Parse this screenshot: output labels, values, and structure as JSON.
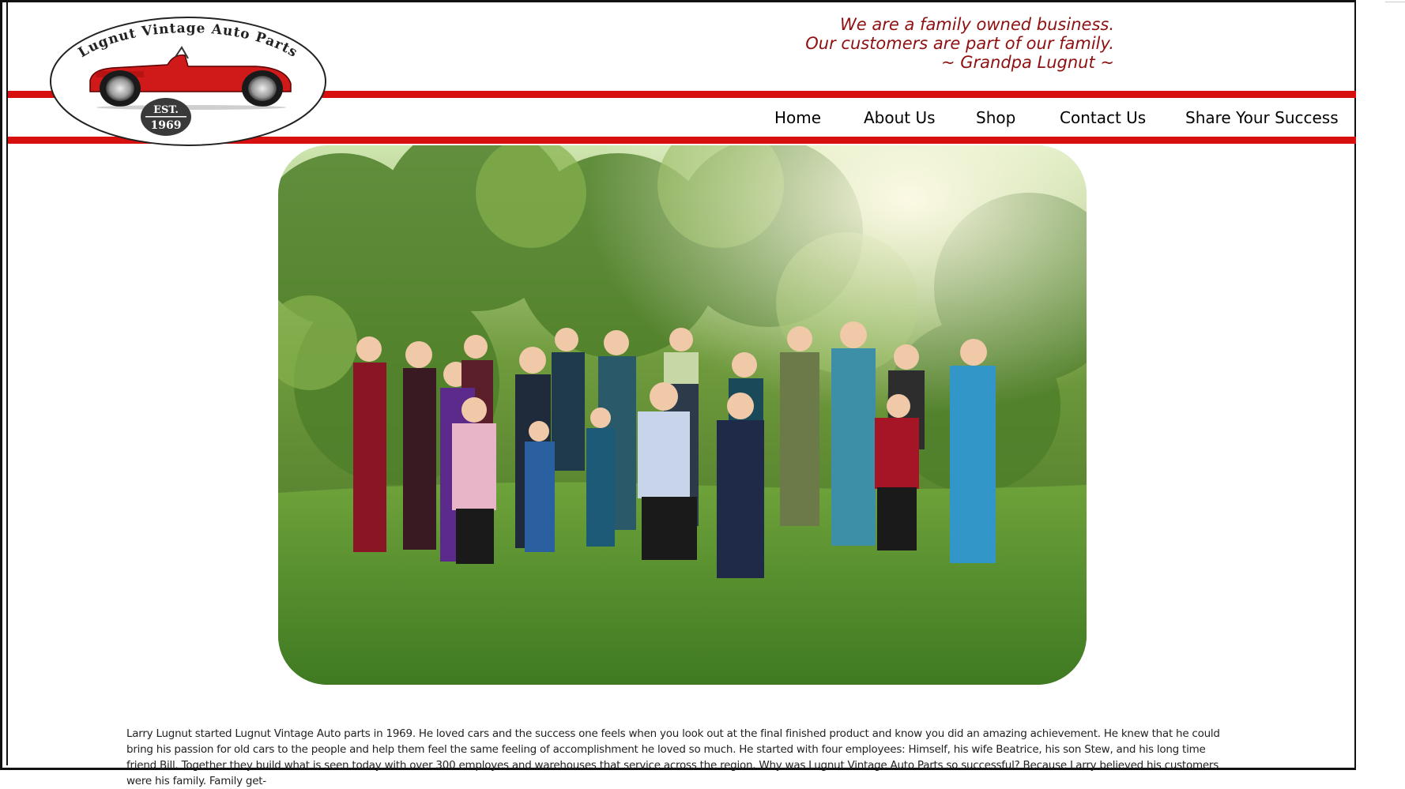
{
  "header": {
    "logo": {
      "arc_text": "Lugnut Vintage Auto Parts",
      "est_line1": "EST.",
      "est_line2": "1969"
    },
    "quote": {
      "line1": "We are a family owned business.",
      "line2": "Our customers are part of our family.",
      "line3": "~ Grandpa Lugnut ~"
    }
  },
  "nav": {
    "items": [
      {
        "label": "Home"
      },
      {
        "label": "About Us"
      },
      {
        "label": "Shop"
      },
      {
        "label": "Contact Us"
      },
      {
        "label": "Share Your Success"
      }
    ]
  },
  "main": {
    "photo_icon": "family-photo",
    "about_text": "Larry Lugnut started Lugnut Vintage Auto parts in 1969. He loved cars and the success one feels when you look out at the final finished product and know you did an amazing achievement. He knew that he could bring his passion for old cars to the people and help them feel the same feeling of accomplishment he loved so much. He started with four employees: Himself, his wife Beatrice, his son Stew, and his long time friend Bill. Together they build what is seen today with over 300 employes and warehouses that service across the region. Why was Lugnut Vintage Auto Parts so successful? Because Larry believed his customers were his family. Family get-"
  },
  "colors": {
    "brand_red": "#d80f0f",
    "quote_red": "#8e1010"
  }
}
